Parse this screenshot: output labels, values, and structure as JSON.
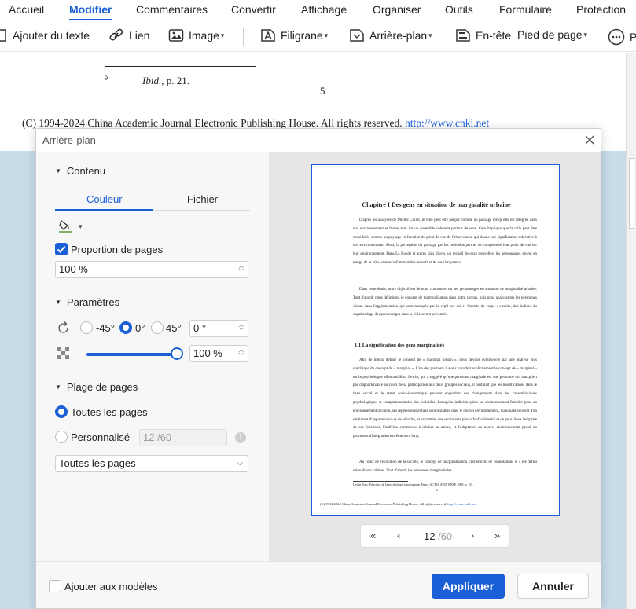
{
  "menu": {
    "items": [
      "Accueil",
      "Modifier",
      "Commentaires",
      "Convertir",
      "Affichage",
      "Organiser",
      "Outils",
      "Formulaire",
      "Protection"
    ],
    "active": "Modifier"
  },
  "toolbar": {
    "add_text": "Ajouter du texte",
    "link": "Lien",
    "image": "Image",
    "watermark": "Filigrane",
    "background": "Arrière-plan",
    "header": "En-tête",
    "footer": "Pied de page",
    "more": "Pl"
  },
  "document": {
    "footnote_num": "9",
    "footnote_ref": "Ibid.",
    "footnote_page": ", p. 21.",
    "page_number": "5",
    "copyright": "(C) 1994-2024 China Academic Journal Electronic Publishing House. All rights reserved.",
    "copyright_link": "http://www.cnki.net"
  },
  "dialog": {
    "title": "Arrière-plan",
    "sections": {
      "content": "Contenu",
      "params": "Paramètres",
      "range": "Plage de pages"
    },
    "tabs": {
      "color": "Couleur",
      "file": "Fichier",
      "active": "Couleur"
    },
    "fill_color": "#7fb069",
    "page_ratio_label": "Proportion de pages",
    "page_ratio_checked": true,
    "page_ratio_value": "100 %",
    "rotation": {
      "options": [
        "-45°",
        "0°",
        "45°"
      ],
      "selected": "0°",
      "value": "0 °"
    },
    "opacity": {
      "value": "100 %",
      "fraction": 1.0
    },
    "range": {
      "all_label": "Toutes les pages",
      "custom_label": "Personnalisé",
      "custom_placeholder": "12 /60",
      "selected": "Toutes les pages",
      "subset": "Toutes les pages"
    },
    "preview": {
      "title": "Chapitre I Des gens en situation de marginalité urbaine",
      "para1": "D'après les analyses de Michel Collot, le ville peut être perçue comme un paysage lorsqu'elle est intégrée dans son environnement et forme avec lui un ensemble cohérent porteur de sens. Cela implique que la ville peut être considérée comme un paysage en fonction du point de vue de l'observateur, qui donne une signification subjective à son environnement. Ainsi, la perception du paysage par les individus permet de comprendre leur point de vue sur leur environnement. Dans La Ronde et autres faits divers, un recueil de onze nouvelles, les personnages vivent en marge de la ville, entourés d'immeubles massifs et de rues bruyantes.",
      "para2": "Dans cette étude, notre objectif est de nous concentrer sur les personnages en situation de marginalité urbaine. Tout d'abord, nous définirons le concept de marginalisation dans notre corpus, puis nous analyserons les personnes vivant dans l'agglomération qui sont marqués par le repli sur soi et l'inertie du corps ; ensuite, des indices du vagabondage des personnages dans la ville seront présentés.",
      "subtitle": "1.1 La signification des gens marginalisés",
      "para3": "Afin de mieux définir le concept de « marginal urbain », nous devons commencer par une analyse plus spécifique du concept de « marginal ». L'un des premiers à avoir introduit explicitement le concept de « marginal » est le psychologue allemand Kurt Lewin, qui a suggéré qu'une personne marginale est une personne qui n'acquiert pas d'appartenance au cours de sa participation aux deux groupes sociaux, il postulait que les modifications dans le tissu social et le statut socio-économique peuvent engendrer des changements dans les caractéristiques psychologiques et comportementales des individus. Lorsqu'un individu quitte un environnement familier pour un environnement inconnu, ses repères existentiels sont instables dans le nouvel environnement, manquant souvent d'un sentiment d'appartenance et de sécurité, et exprimant des sentiments plus vifs d'infériorité et de peur. Sous l'emprise de ces émotions, l'individu commence à inhiber sa nature, et l'adaptation au nouvel environnement prend un processus d'intégration extrêmement long.",
      "para4": "Au cours de l'évolution de la société, le concept de marginalisation s'est enrichi de connotations et a été défini selon divers critères. Tout d'abord, les personnes marginalisées",
      "footnote": "Lewin Kurt, Principes de la psychologie topologique, Paris : ACTES SUD/ ENSP, 2005, p. 181.",
      "page_num": "6",
      "copyright": "(C) 1994-2024 China Academic Journal Electronic Publishing House. All rights reserved.",
      "copyright_link": "http://www.cnki.net"
    },
    "pager": {
      "current": "12",
      "total": "/60"
    },
    "add_to_templates": "Ajouter aux modèles",
    "apply": "Appliquer",
    "cancel": "Annuler"
  },
  "colors": {
    "accent": "#1a5fd6",
    "page_background": "#c8dbe9"
  }
}
